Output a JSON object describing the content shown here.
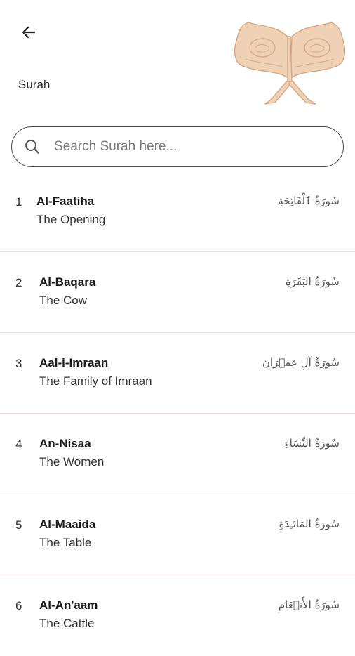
{
  "header": {
    "title": "Surah",
    "back_icon": "arrow-left-icon",
    "illustration": "quran-book-stand-illustration"
  },
  "search": {
    "placeholder": "Search Surah here...",
    "value": "",
    "icon": "search-icon"
  },
  "colors": {
    "divider": "#f3d9dc",
    "illustration": "#e8c4a4",
    "text": "#1a1a1a"
  },
  "surahs": [
    {
      "number": "1",
      "name": "Al-Faatiha",
      "meaning": "The Opening",
      "arabic": "سُورَةُ ٱلْفَاتِحَةِ"
    },
    {
      "number": "2",
      "name": "Al-Baqara",
      "meaning": "The Cow",
      "arabic": "سُورَةُ البَقَرَةِ"
    },
    {
      "number": "3",
      "name": "Aal-i-Imraan",
      "meaning": "The Family of Imraan",
      "arabic": "سُورَةُ آلِ عِمۡرَانَ"
    },
    {
      "number": "4",
      "name": "An-Nisaa",
      "meaning": "The Women",
      "arabic": "سُورَةُ النِّسَاءِ"
    },
    {
      "number": "5",
      "name": "Al-Maaida",
      "meaning": "The Table",
      "arabic": "سُورَةُ المَائـِدَةِ"
    },
    {
      "number": "6",
      "name": "Al-An'aam",
      "meaning": "The Cattle",
      "arabic": "سُورَةُ الأَنۡعَامِ"
    }
  ]
}
